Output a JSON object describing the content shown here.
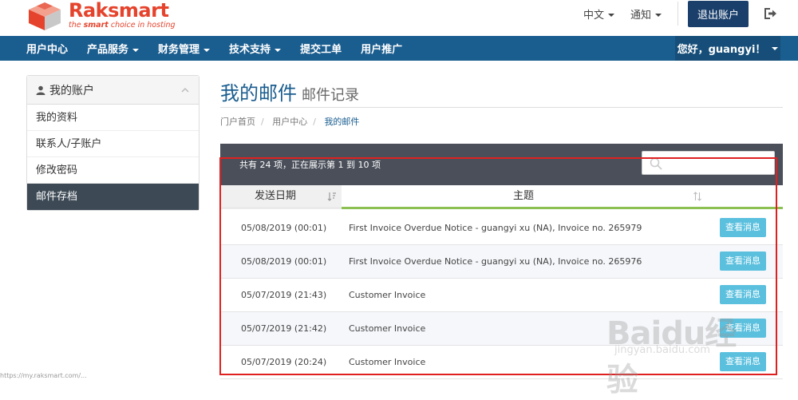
{
  "header": {
    "brand": "Raksmart",
    "tagline_pre": "the ",
    "tagline_bold": "smart",
    "tagline_post": " choice in hosting",
    "lang": "中文",
    "notify": "通知",
    "logout": "退出账户",
    "colors": {
      "brand": "#e5432c",
      "navy": "#1a3f6b",
      "nav": "#1a5d8f"
    }
  },
  "nav": {
    "items": [
      "用户中心",
      "产品服务",
      "财务管理",
      "技术支持",
      "提交工单",
      "用户推广"
    ],
    "user": "您好，guangyi！"
  },
  "sidebar": {
    "title": "我的账户",
    "items": [
      "我的资料",
      "联系人/子账户",
      "修改密码",
      "邮件存档"
    ]
  },
  "page": {
    "title": "我的邮件",
    "subtitle": "邮件记录",
    "breadcrumb": [
      "门户首页",
      "用户中心",
      "我的邮件"
    ]
  },
  "table": {
    "info": "共有 24 项，正在展示第 1 到 10 项",
    "col_date": "发送日期",
    "col_subject": "主题",
    "action_label": "查看消息",
    "rows": [
      {
        "date": "05/08/2019 (00:01)",
        "subject": "First Invoice Overdue Notice - guangyi xu (NA), Invoice no. 265979"
      },
      {
        "date": "05/08/2019 (00:01)",
        "subject": "First Invoice Overdue Notice - guangyi xu (NA), Invoice no. 265976"
      },
      {
        "date": "05/07/2019 (21:43)",
        "subject": "Customer Invoice"
      },
      {
        "date": "05/07/2019 (21:42)",
        "subject": "Customer Invoice"
      },
      {
        "date": "05/07/2019 (20:24)",
        "subject": "Customer Invoice"
      }
    ]
  },
  "status_url": "https://my.raksmart.com/...",
  "watermark": {
    "main": "Baidu经验",
    "sub": "jingyan.baidu.com"
  }
}
